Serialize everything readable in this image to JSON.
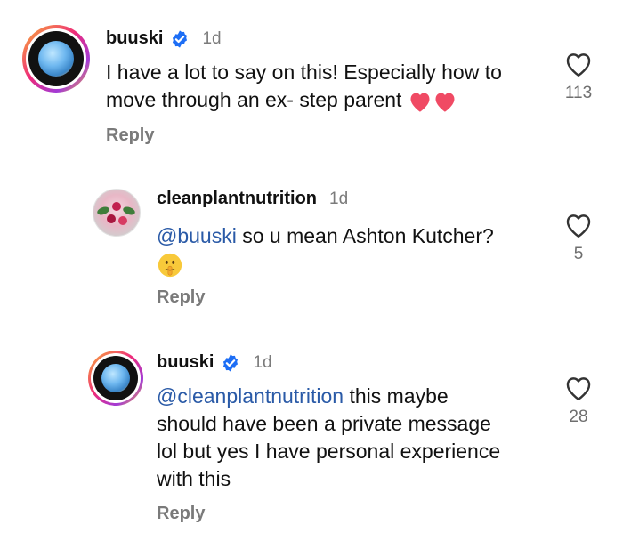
{
  "comments": [
    {
      "username": "buuski",
      "verified": true,
      "time": "1d",
      "text": "I have a lot to say on this! Especially how to move through an ex- step parent",
      "emoji": [
        "heart",
        "heart"
      ],
      "reply_label": "Reply",
      "likes": "113"
    },
    {
      "username": "cleanplantnutrition",
      "verified": false,
      "time": "1d",
      "mention": "@buuski",
      "text": "so u mean Ashton Kutcher?",
      "emoji": [
        "shushing-face"
      ],
      "reply_label": "Reply",
      "likes": "5"
    },
    {
      "username": "buuski",
      "verified": true,
      "time": "1d",
      "mention": "@cleanplantnutrition",
      "text_line1": "this maybe",
      "text_line2": "should have been a private message",
      "text_line3": "lol but yes I have personal experience",
      "text_line4": "with this",
      "reply_label": "Reply",
      "likes": "28"
    }
  ],
  "colors": {
    "mention": "#2a5aa7",
    "verified": "#1d6ef5",
    "heart": "#f04a64",
    "muted": "#7a7a7a"
  }
}
